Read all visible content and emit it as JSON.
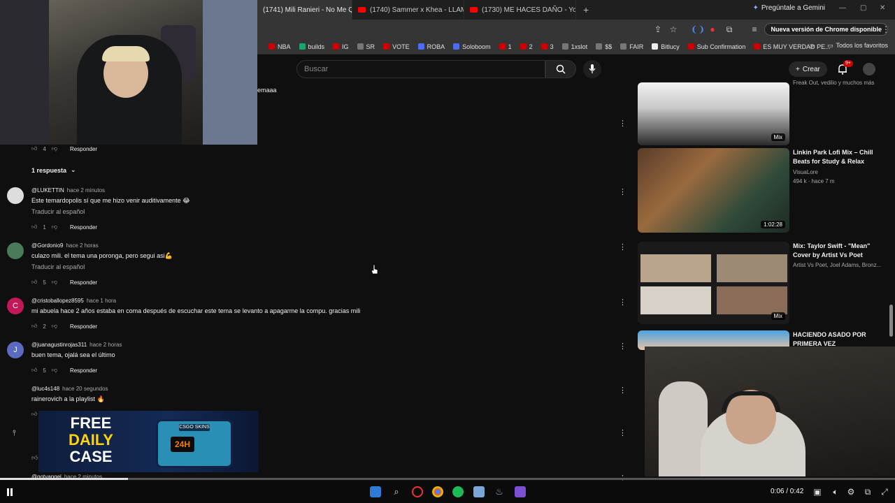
{
  "browser": {
    "tabs": [
      {
        "label": "(1741) Mili Ranieri - No Me Qu",
        "active": true
      },
      {
        "label": "(1740) Sammer x Khea - LLAMA",
        "active": false
      },
      {
        "label": "(1730) ME HACES DAÑO - You",
        "active": false
      }
    ],
    "gemini_label": "Pregúntale a Gemini",
    "chrome_update_label": "Nueva versión de Chrome disponible",
    "bookmarks": [
      {
        "label": "NBA",
        "icon": "red"
      },
      {
        "label": "builds",
        "icon": "green"
      },
      {
        "label": "IG",
        "icon": "red"
      },
      {
        "label": "SR",
        "icon": "grey"
      },
      {
        "label": "VOTE",
        "icon": "red"
      },
      {
        "label": "ROBA",
        "icon": "blue"
      },
      {
        "label": "Soloboom",
        "icon": "blue"
      },
      {
        "label": "1",
        "icon": "red"
      },
      {
        "label": "2",
        "icon": "red"
      },
      {
        "label": "3",
        "icon": "red"
      },
      {
        "label": "1xslot",
        "icon": "grey"
      },
      {
        "label": "$$",
        "icon": "grey"
      },
      {
        "label": "FAIR",
        "icon": "grey"
      },
      {
        "label": "Bitlucy",
        "icon": "white"
      },
      {
        "label": "Sub Confirmation",
        "icon": "red"
      },
      {
        "label": "ES MUY VERDAD PE...",
        "icon": "red"
      }
    ],
    "all_bookmarks_label": "Todos los favoritos"
  },
  "youtube": {
    "search_placeholder": "Buscar",
    "create_label": "Crear",
    "notifications_badge": "9+"
  },
  "comments": {
    "partial_text": "emaaa",
    "first_likes": "4",
    "reply_label": "Responder",
    "replies_toggle": "1 respuesta",
    "items": [
      {
        "author": "@LUKETTIN",
        "time": "hace 2 minutos",
        "text": "Este temardopolis sí que me hizo venir auditivamente 😂",
        "translate": "Traducir al español",
        "likes": "1",
        "avatar": ""
      },
      {
        "author": "@Gordonio9",
        "time": "hace 2 horas",
        "text": "culazo mili. el tema una poronga, pero segui asi💪",
        "translate": "Traducir al español",
        "likes": "5",
        "avatar": ""
      },
      {
        "author": "@cristoballopez8595",
        "time": "hace 1 hora",
        "text": "mi abuela hace 2 años estaba en coma después de escuchar este tema se levanto a apagarme la compu. gracias mili",
        "translate": "",
        "likes": "2",
        "avatar": "C"
      },
      {
        "author": "@juanagustinrojas311",
        "time": "hace 2 horas",
        "text": "buen tema, ojalá sea el último",
        "translate": "",
        "likes": "5",
        "avatar": "J"
      },
      {
        "author": "@luc4s148",
        "time": "hace 20 segundos",
        "text": "rainerovich a la playlist 🔥",
        "translate": "",
        "likes": "",
        "avatar": ""
      },
      {
        "author": "@gotyangel",
        "time": "hace 2 minutos",
        "text": "",
        "translate": "",
        "likes": "",
        "avatar": ""
      }
    ]
  },
  "sidebar": {
    "top_meta": "Freak Out, vedilio y muchos más",
    "videos": [
      {
        "title": "Linkin Park Lofi Mix – Chill Beats for Study & Relax",
        "channel": "VisuaLore",
        "stats": "494 k · hace 7 m",
        "duration": "1:02:28"
      },
      {
        "title": "Mix: Taylor Swift - \"Mean\" Cover by Artist Vs Poet",
        "channel": "Artist Vs Poet, Joel Adams, Bronz...",
        "stats": "",
        "duration": "Mix"
      },
      {
        "title": "HACIENDO ASADO POR PRIMERA VEZ",
        "channel": "",
        "stats": "",
        "duration": ""
      }
    ],
    "first_duration": "Mix"
  },
  "ad": {
    "line1": "FREE",
    "line2": "DAILY",
    "line3": "CASE",
    "box_screen": "24H",
    "box_logo": "CSGO SKINS"
  },
  "player": {
    "time_current": "0:06",
    "time_total": "0:42",
    "time_display": "0:06 / 0:42",
    "progress_fraction": 0.143
  }
}
